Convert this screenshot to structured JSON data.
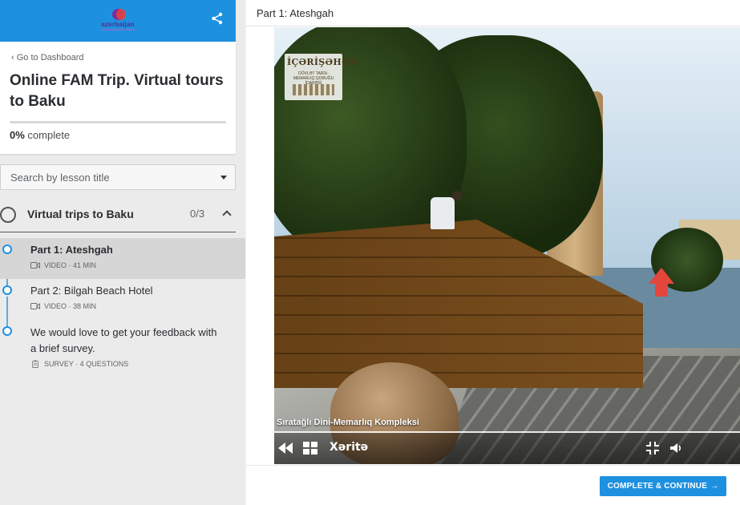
{
  "brand": {
    "logo_text": "azerbaijan",
    "accent": "#1e90e0"
  },
  "course": {
    "back_label": "Go to Dashboard",
    "title": "Online FAM Trip. Virtual tours to Baku",
    "progress_percent": 0,
    "progress_value": "0%",
    "progress_suffix": " complete"
  },
  "search": {
    "placeholder": "Search by lesson title"
  },
  "section": {
    "title": "Virtual trips to Baku",
    "count": "0/3"
  },
  "lessons": [
    {
      "title": "Part 1: Ateshgah",
      "meta": "VIDEO · 41 MIN",
      "type_icon": "video-icon",
      "active": true
    },
    {
      "title": "Part 2: Bilgah Beach Hotel",
      "meta": "VIDEO · 38 MIN",
      "type_icon": "video-icon",
      "active": false
    },
    {
      "title": "We would love to get your feedback with a brief survey.",
      "meta": "SURVEY · 4 QUESTIONS",
      "type_icon": "survey-icon",
      "active": false
    }
  ],
  "main": {
    "title": "Part 1: Ateshgah"
  },
  "tour": {
    "watermark_title": "İÇƏRİŞƏHƏR",
    "watermark_sub": "DÖVLƏT TARİX-MEMARLIQ QORUĞU İDARƏSİ",
    "caption": "Sıratağlı Dini-Memarlıq Kompleksi",
    "map_label": "Xəritə"
  },
  "footer": {
    "cta_label": "COMPLETE & CONTINUE",
    "cta_arrow": "→"
  }
}
